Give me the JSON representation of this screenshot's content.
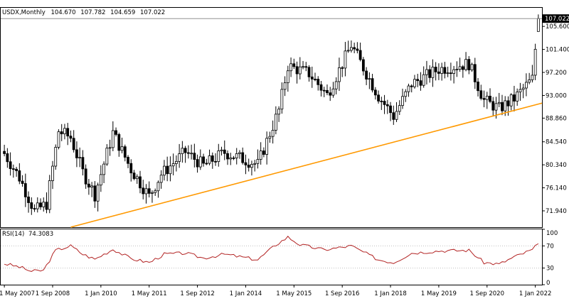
{
  "header": {
    "symbol": "USDX,Monthly",
    "open": "104.670",
    "high": "107.782",
    "low": "104.659",
    "close": "107.022"
  },
  "rsi_header": {
    "name": "RSI(14)",
    "value": "74.3083"
  },
  "colors": {
    "trendline": "#ff9900",
    "rsi_line": "#b22222",
    "candle_up": "#ffffff",
    "candle_down": "#000000",
    "last_price_bg": "#000000",
    "level_dots": "#c0c0c0"
  },
  "chart_data": [
    {
      "type": "candlestick",
      "title": "USDX,Monthly",
      "ylim": [
        68.96,
        108.99
      ],
      "y_ticks": [
        "105.600",
        "101.400",
        "97.200",
        "93.000",
        "88.860",
        "84.540",
        "80.340",
        "76.140",
        "71.940"
      ],
      "last_price": "107.022",
      "x_ticks": [
        "1 May 2007",
        "1 Sep 2008",
        "1 Jan 2010",
        "1 May 2011",
        "1 Sep 2012",
        "1 Jan 2014",
        "1 May 2015",
        "1 Sep 2016",
        "1 Jan 2018",
        "1 May 2019",
        "1 Sep 2020",
        "1 Jan 2022"
      ],
      "period_start": "2007-05",
      "period_end": "2022-02",
      "close_path": [
        {
          "date": "2007-05",
          "value": 82.4
        },
        {
          "date": "2007-10",
          "value": 78.0
        },
        {
          "date": "2008-03",
          "value": 71.9
        },
        {
          "date": "2008-07",
          "value": 73.2
        },
        {
          "date": "2008-11",
          "value": 86.5
        },
        {
          "date": "2009-03",
          "value": 85.3
        },
        {
          "date": "2009-07",
          "value": 79.0
        },
        {
          "date": "2009-11",
          "value": 74.9
        },
        {
          "date": "2010-05",
          "value": 86.2
        },
        {
          "date": "2010-11",
          "value": 79.5
        },
        {
          "date": "2011-05",
          "value": 74.6
        },
        {
          "date": "2011-09",
          "value": 78.6
        },
        {
          "date": "2012-05",
          "value": 82.7
        },
        {
          "date": "2012-11",
          "value": 80.2
        },
        {
          "date": "2013-06",
          "value": 82.6
        },
        {
          "date": "2014-05",
          "value": 80.4
        },
        {
          "date": "2014-12",
          "value": 90.3
        },
        {
          "date": "2015-03",
          "value": 98.4
        },
        {
          "date": "2015-10",
          "value": 97.0
        },
        {
          "date": "2016-04",
          "value": 93.1
        },
        {
          "date": "2016-12",
          "value": 102.2
        },
        {
          "date": "2017-09",
          "value": 92.9
        },
        {
          "date": "2018-02",
          "value": 89.2
        },
        {
          "date": "2018-08",
          "value": 95.1
        },
        {
          "date": "2019-05",
          "value": 97.8
        },
        {
          "date": "2020-03",
          "value": 98.8
        },
        {
          "date": "2020-08",
          "value": 92.1
        },
        {
          "date": "2021-01",
          "value": 90.6
        },
        {
          "date": "2021-06",
          "value": 92.4
        },
        {
          "date": "2021-12",
          "value": 96.0
        },
        {
          "date": "2022-02",
          "value": 107.0
        }
      ],
      "trendline": {
        "from": {
          "date": "2009-03",
          "value": 68.96
        },
        "to": {
          "date": "2022-02",
          "value": 91.6
        }
      }
    },
    {
      "type": "line",
      "title": "RSI(14)",
      "ylim": [
        0,
        100
      ],
      "y_ticks": [
        100,
        70,
        30,
        0
      ],
      "levels": [
        70,
        30
      ],
      "series": [
        {
          "values": [
            {
              "date": "2007-05",
              "value": 38
            },
            {
              "date": "2007-10",
              "value": 32
            },
            {
              "date": "2008-02",
              "value": 24
            },
            {
              "date": "2008-06",
              "value": 26
            },
            {
              "date": "2008-10",
              "value": 62
            },
            {
              "date": "2009-03",
              "value": 70
            },
            {
              "date": "2009-07",
              "value": 55
            },
            {
              "date": "2009-11",
              "value": 46
            },
            {
              "date": "2010-05",
              "value": 64
            },
            {
              "date": "2010-11",
              "value": 47
            },
            {
              "date": "2011-05",
              "value": 40
            },
            {
              "date": "2011-10",
              "value": 55
            },
            {
              "date": "2012-05",
              "value": 57
            },
            {
              "date": "2012-11",
              "value": 48
            },
            {
              "date": "2013-06",
              "value": 55
            },
            {
              "date": "2014-05",
              "value": 45
            },
            {
              "date": "2014-11",
              "value": 72
            },
            {
              "date": "2015-03",
              "value": 86
            },
            {
              "date": "2015-07",
              "value": 72
            },
            {
              "date": "2016-03",
              "value": 63
            },
            {
              "date": "2016-12",
              "value": 70
            },
            {
              "date": "2017-09",
              "value": 45
            },
            {
              "date": "2018-02",
              "value": 40
            },
            {
              "date": "2018-08",
              "value": 57
            },
            {
              "date": "2019-05",
              "value": 61
            },
            {
              "date": "2020-03",
              "value": 62
            },
            {
              "date": "2020-08",
              "value": 40
            },
            {
              "date": "2021-01",
              "value": 37
            },
            {
              "date": "2021-06",
              "value": 50
            },
            {
              "date": "2021-12",
              "value": 63
            },
            {
              "date": "2022-02",
              "value": 74
            }
          ]
        }
      ]
    }
  ]
}
